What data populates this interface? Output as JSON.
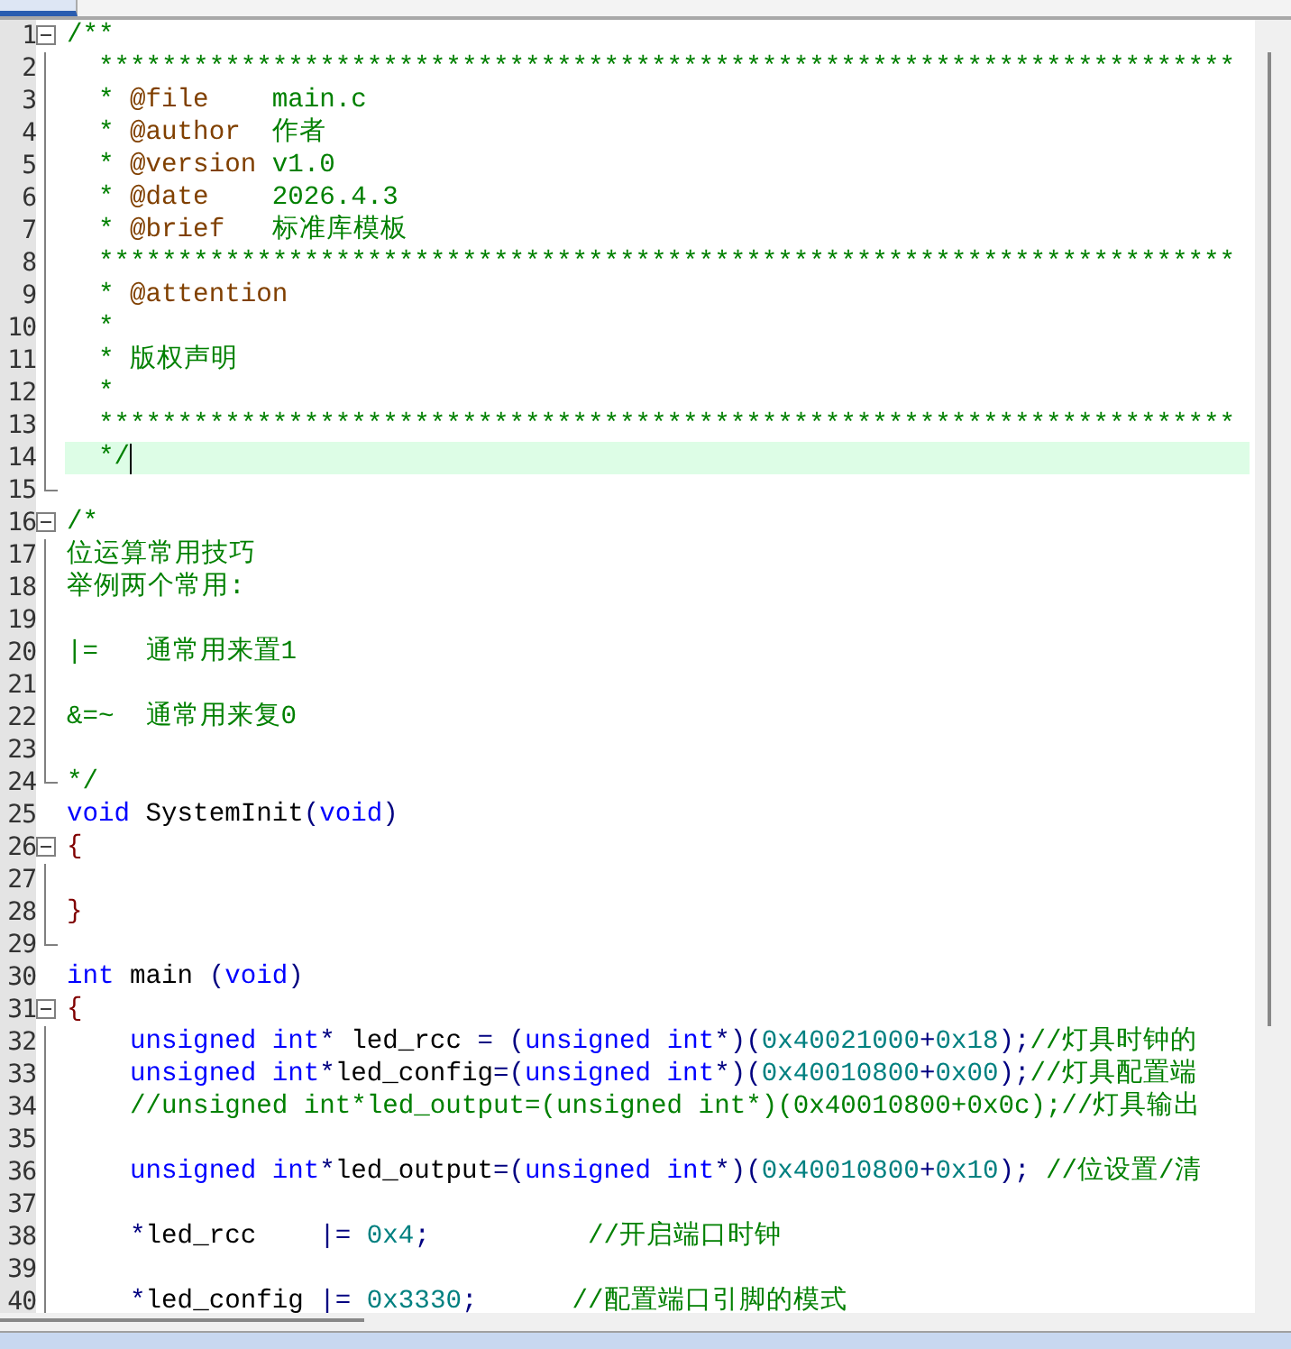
{
  "editor": {
    "lines": [
      {
        "number": "1",
        "kind": "start",
        "current": false,
        "tokens": [
          {
            "kind": "comment",
            "text": "/**"
          }
        ]
      },
      {
        "number": "2",
        "kind": "body",
        "current": false,
        "tokens": [
          {
            "kind": "comment",
            "text": "  ************************************************************************"
          }
        ]
      },
      {
        "number": "3",
        "kind": "body",
        "current": false,
        "tokens": [
          {
            "kind": "comment",
            "text": "  * "
          },
          {
            "kind": "doctag",
            "text": "@file"
          },
          {
            "kind": "comment",
            "text": "    main.c"
          }
        ]
      },
      {
        "number": "4",
        "kind": "body",
        "current": false,
        "tokens": [
          {
            "kind": "comment",
            "text": "  * "
          },
          {
            "kind": "doctag",
            "text": "@author"
          },
          {
            "kind": "comment",
            "text": "  作者"
          }
        ]
      },
      {
        "number": "5",
        "kind": "body",
        "current": false,
        "tokens": [
          {
            "kind": "comment",
            "text": "  * "
          },
          {
            "kind": "doctag",
            "text": "@version"
          },
          {
            "kind": "comment",
            "text": " v1.0"
          }
        ]
      },
      {
        "number": "6",
        "kind": "body",
        "current": false,
        "tokens": [
          {
            "kind": "comment",
            "text": "  * "
          },
          {
            "kind": "doctag",
            "text": "@date"
          },
          {
            "kind": "comment",
            "text": "    2026.4.3"
          }
        ]
      },
      {
        "number": "7",
        "kind": "body",
        "current": false,
        "tokens": [
          {
            "kind": "comment",
            "text": "  * "
          },
          {
            "kind": "doctag",
            "text": "@brief"
          },
          {
            "kind": "comment",
            "text": "   标准库模板"
          }
        ]
      },
      {
        "number": "8",
        "kind": "body",
        "current": false,
        "tokens": [
          {
            "kind": "comment",
            "text": "  ************************************************************************"
          }
        ]
      },
      {
        "number": "9",
        "kind": "body",
        "current": false,
        "tokens": [
          {
            "kind": "comment",
            "text": "  * "
          },
          {
            "kind": "doctag",
            "text": "@attention"
          }
        ]
      },
      {
        "number": "10",
        "kind": "body",
        "current": false,
        "tokens": [
          {
            "kind": "comment",
            "text": "  *"
          }
        ]
      },
      {
        "number": "11",
        "kind": "body",
        "current": false,
        "tokens": [
          {
            "kind": "comment",
            "text": "  * 版权声明"
          }
        ]
      },
      {
        "number": "12",
        "kind": "body",
        "current": false,
        "tokens": [
          {
            "kind": "comment",
            "text": "  *"
          }
        ]
      },
      {
        "number": "13",
        "kind": "body",
        "current": false,
        "tokens": [
          {
            "kind": "comment",
            "text": "  ************************************************************************"
          }
        ]
      },
      {
        "number": "14",
        "kind": "body",
        "current": true,
        "tokens": [
          {
            "kind": "comment",
            "text": "  */"
          }
        ]
      },
      {
        "number": "15",
        "kind": "end",
        "current": false
      },
      {
        "number": "16",
        "kind": "start",
        "current": false,
        "tokens": [
          {
            "kind": "comment",
            "text": "/*"
          }
        ]
      },
      {
        "number": "17",
        "kind": "body",
        "current": false,
        "tokens": [
          {
            "kind": "comment",
            "text": "位运算常用技巧"
          }
        ]
      },
      {
        "number": "18",
        "kind": "body",
        "current": false,
        "tokens": [
          {
            "kind": "comment",
            "text": "举例两个常用:"
          }
        ]
      },
      {
        "number": "19",
        "kind": "body",
        "current": false
      },
      {
        "number": "20",
        "kind": "body",
        "current": false,
        "tokens": [
          {
            "kind": "comment",
            "text": "|=   通常用来置1"
          }
        ]
      },
      {
        "number": "21",
        "kind": "body",
        "current": false
      },
      {
        "number": "22",
        "kind": "body",
        "current": false,
        "tokens": [
          {
            "kind": "comment",
            "text": "&=~  通常用来复0"
          }
        ]
      },
      {
        "number": "23",
        "kind": "body",
        "current": false
      },
      {
        "number": "24",
        "kind": "end",
        "current": false,
        "tokens": [
          {
            "kind": "comment",
            "text": "*/"
          }
        ]
      },
      {
        "number": "25",
        "kind": "plain",
        "current": false,
        "tokens": [
          {
            "kind": "keyword",
            "text": "void"
          },
          {
            "kind": "plain",
            "text": " SystemInit"
          },
          {
            "kind": "punct",
            "text": "("
          },
          {
            "kind": "keyword",
            "text": "void"
          },
          {
            "kind": "punct",
            "text": ")"
          }
        ]
      },
      {
        "number": "26",
        "kind": "start",
        "current": false,
        "tokens": [
          {
            "kind": "brace",
            "text": "{"
          }
        ]
      },
      {
        "number": "27",
        "kind": "body",
        "current": false
      },
      {
        "number": "28",
        "kind": "body",
        "current": false,
        "tokens": [
          {
            "kind": "brace",
            "text": "}"
          }
        ]
      },
      {
        "number": "29",
        "kind": "end",
        "current": false
      },
      {
        "number": "30",
        "kind": "plain",
        "current": false,
        "tokens": [
          {
            "kind": "keyword",
            "text": "int"
          },
          {
            "kind": "plain",
            "text": " main "
          },
          {
            "kind": "punct",
            "text": "("
          },
          {
            "kind": "keyword",
            "text": "void"
          },
          {
            "kind": "punct",
            "text": ")"
          }
        ]
      },
      {
        "number": "31",
        "kind": "start",
        "current": false,
        "tokens": [
          {
            "kind": "brace",
            "text": "{"
          }
        ]
      },
      {
        "number": "32",
        "kind": "body",
        "current": false,
        "tokens": [
          {
            "kind": "keyword",
            "text": "    unsigned"
          },
          {
            "kind": "keyword",
            "text": " int"
          },
          {
            "kind": "punct",
            "text": "*"
          },
          {
            "kind": "plain",
            "text": " led_rcc "
          },
          {
            "kind": "punct",
            "text": "= ("
          },
          {
            "kind": "keyword",
            "text": "unsigned"
          },
          {
            "kind": "keyword",
            "text": " int"
          },
          {
            "kind": "punct",
            "text": "*)("
          },
          {
            "kind": "number",
            "text": "0x40021000"
          },
          {
            "kind": "punct",
            "text": "+"
          },
          {
            "kind": "number",
            "text": "0x18"
          },
          {
            "kind": "punct",
            "text": ");"
          },
          {
            "kind": "comment",
            "text": "//灯具时钟的"
          }
        ]
      },
      {
        "number": "33",
        "kind": "body",
        "current": false,
        "tokens": [
          {
            "kind": "keyword",
            "text": "    unsigned"
          },
          {
            "kind": "keyword",
            "text": " int"
          },
          {
            "kind": "punct",
            "text": "*"
          },
          {
            "kind": "plain",
            "text": "led_config"
          },
          {
            "kind": "punct",
            "text": "=("
          },
          {
            "kind": "keyword",
            "text": "unsigned"
          },
          {
            "kind": "keyword",
            "text": " int"
          },
          {
            "kind": "punct",
            "text": "*)("
          },
          {
            "kind": "number",
            "text": "0x40010800"
          },
          {
            "kind": "punct",
            "text": "+"
          },
          {
            "kind": "number",
            "text": "0x00"
          },
          {
            "kind": "punct",
            "text": ");"
          },
          {
            "kind": "comment",
            "text": "//灯具配置端"
          }
        ]
      },
      {
        "number": "34",
        "kind": "body",
        "current": false,
        "tokens": [
          {
            "kind": "comment",
            "text": "    //unsigned int*led_output=(unsigned int*)(0x40010800+0x0c);//灯具输出"
          }
        ]
      },
      {
        "number": "35",
        "kind": "body",
        "current": false
      },
      {
        "number": "36",
        "kind": "body",
        "current": false,
        "tokens": [
          {
            "kind": "keyword",
            "text": "    unsigned"
          },
          {
            "kind": "keyword",
            "text": " int"
          },
          {
            "kind": "punct",
            "text": "*"
          },
          {
            "kind": "plain",
            "text": "led_output"
          },
          {
            "kind": "punct",
            "text": "=("
          },
          {
            "kind": "keyword",
            "text": "unsigned"
          },
          {
            "kind": "keyword",
            "text": " int"
          },
          {
            "kind": "punct",
            "text": "*)("
          },
          {
            "kind": "number",
            "text": "0x40010800"
          },
          {
            "kind": "punct",
            "text": "+"
          },
          {
            "kind": "number",
            "text": "0x10"
          },
          {
            "kind": "punct",
            "text": ");"
          },
          {
            "kind": "comment",
            "text": " //位设置/清"
          }
        ]
      },
      {
        "number": "37",
        "kind": "body",
        "current": false
      },
      {
        "number": "38",
        "kind": "body",
        "current": false,
        "tokens": [
          {
            "kind": "punct",
            "text": "    *"
          },
          {
            "kind": "plain",
            "text": "led_rcc    "
          },
          {
            "kind": "punct",
            "text": "|="
          },
          {
            "kind": "number",
            "text": " 0x4"
          },
          {
            "kind": "punct",
            "text": ";"
          },
          {
            "kind": "comment",
            "text": "          //开启端口时钟"
          }
        ]
      },
      {
        "number": "39",
        "kind": "body",
        "current": false
      },
      {
        "number": "40",
        "kind": "body",
        "current": false,
        "tokens": [
          {
            "kind": "punct",
            "text": "    *"
          },
          {
            "kind": "plain",
            "text": "led_config "
          },
          {
            "kind": "punct",
            "text": "|="
          },
          {
            "kind": "number",
            "text": " 0x3330"
          },
          {
            "kind": "punct",
            "text": ";"
          },
          {
            "kind": "comment",
            "text": "      //配置端口引脚的模式"
          }
        ]
      }
    ]
  }
}
